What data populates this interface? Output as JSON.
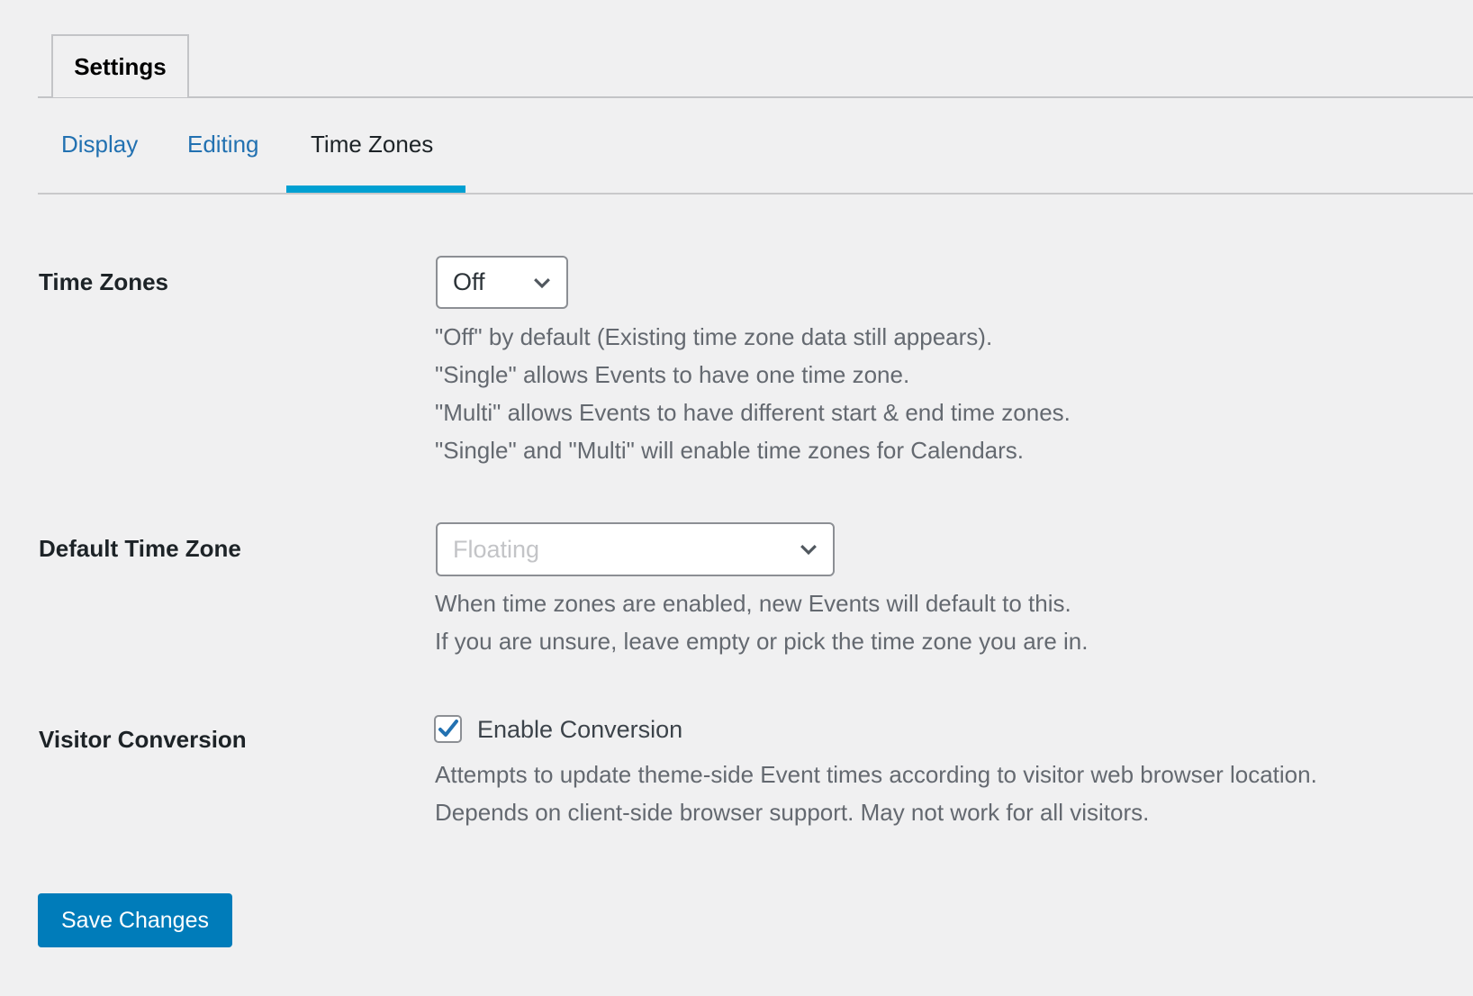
{
  "top_tab": {
    "label": "Settings"
  },
  "sub_tabs": [
    {
      "label": "Display",
      "active": false
    },
    {
      "label": "Editing",
      "active": false
    },
    {
      "label": "Time Zones",
      "active": true
    }
  ],
  "fields": {
    "time_zones": {
      "label": "Time Zones",
      "value": "Off",
      "description": [
        "\"Off\" by default (Existing time zone data still appears).",
        "\"Single\" allows Events to have one time zone.",
        "\"Multi\" allows Events to have different start & end time zones.",
        "\"Single\" and \"Multi\" will enable time zones for Calendars."
      ]
    },
    "default_time_zone": {
      "label": "Default Time Zone",
      "placeholder": "Floating",
      "description": [
        "When time zones are enabled, new Events will default to this.",
        "If you are unsure, leave empty or pick the time zone you are in."
      ]
    },
    "visitor_conversion": {
      "label": "Visitor Conversion",
      "checkbox_label": "Enable Conversion",
      "checked": true,
      "description": [
        "Attempts to update theme-side Event times according to visitor web browser location.",
        "Depends on client-side browser support. May not work for all visitors."
      ]
    }
  },
  "save_button": {
    "label": "Save Changes"
  },
  "colors": {
    "accent": "#00a0d2",
    "link": "#2271b1",
    "primary_button": "#007cba",
    "background": "#f0f0f1"
  }
}
